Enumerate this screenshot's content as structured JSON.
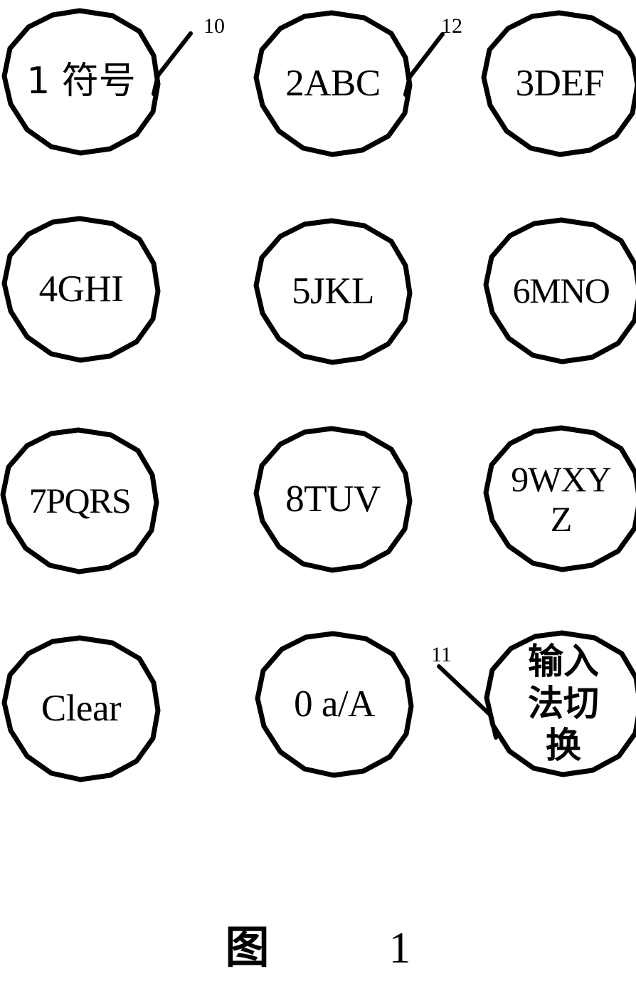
{
  "figure": {
    "caption_char": "图",
    "caption_number": "1",
    "background_color": "#ffffff",
    "ink_color": "#000000"
  },
  "keypad": {
    "rows": 4,
    "columns": 3,
    "keys": [
      {
        "id": "key-1",
        "label": "1 符号",
        "style": "mixed",
        "row": 1,
        "col": 1
      },
      {
        "id": "key-2",
        "label": "2ABC",
        "style": "latin",
        "row": 1,
        "col": 2
      },
      {
        "id": "key-3",
        "label": "3DEF",
        "style": "latin",
        "row": 1,
        "col": 3
      },
      {
        "id": "key-4",
        "label": "4GHI",
        "style": "latin",
        "row": 2,
        "col": 1
      },
      {
        "id": "key-5",
        "label": "5JKL",
        "style": "latin",
        "row": 2,
        "col": 2
      },
      {
        "id": "key-6",
        "label": "6MNO",
        "style": "latin-tight",
        "row": 2,
        "col": 3
      },
      {
        "id": "key-7",
        "label": "7PQRS",
        "style": "latin-tight",
        "row": 3,
        "col": 1
      },
      {
        "id": "key-8",
        "label": "8TUV",
        "style": "latin",
        "row": 3,
        "col": 2
      },
      {
        "id": "key-9",
        "label": "9WXY\nZ",
        "style": "latin-wrap",
        "row": 3,
        "col": 3
      },
      {
        "id": "key-clear",
        "label": "Clear",
        "style": "latin",
        "row": 4,
        "col": 1
      },
      {
        "id": "key-0",
        "label": "0 a/A",
        "style": "latin",
        "row": 4,
        "col": 2
      },
      {
        "id": "key-ime",
        "label": "输入\n法切\n换",
        "style": "cjk",
        "row": 4,
        "col": 3
      }
    ]
  },
  "reference_numerals": [
    {
      "id": "ref-10",
      "text": "10",
      "points_to": "key-1"
    },
    {
      "id": "ref-12",
      "text": "12",
      "points_to": "key-2"
    },
    {
      "id": "ref-11",
      "text": "11",
      "points_to": "key-ime"
    }
  ]
}
